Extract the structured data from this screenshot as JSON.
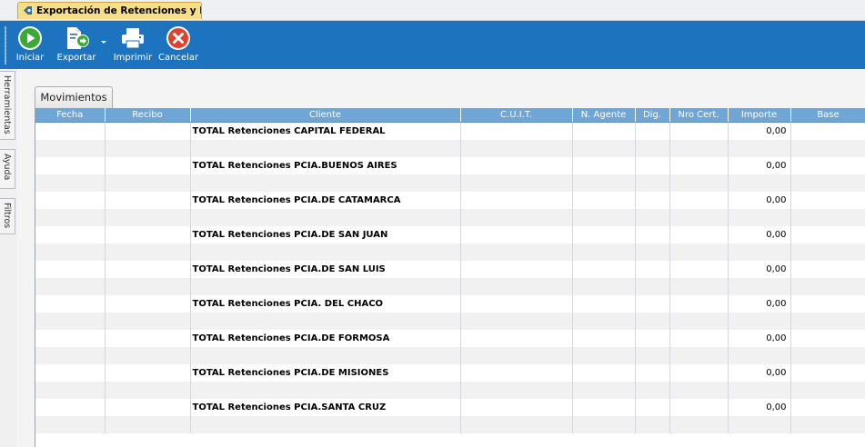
{
  "window": {
    "tab_title": "Exportación de Retenciones y Pe..."
  },
  "toolbar": {
    "iniciar": "Iniciar",
    "exportar": "Exportar",
    "imprimir": "Imprimir",
    "cancelar": "Cancelar"
  },
  "side_tabs": {
    "herramientas": "Herramientas",
    "ayuda": "Ayuda",
    "filtros": "Filtros"
  },
  "grid": {
    "tab_label": "Movimientos",
    "columns": [
      "Fecha",
      "Recibo",
      "Cliente",
      "C.U.I.T.",
      "N. Agente",
      "Dig.",
      "Nro Cert.",
      "Importe",
      "Base"
    ],
    "rows": [
      {
        "cliente": "TOTAL Retenciones CAPITAL FEDERAL",
        "importe": "0,00"
      },
      {
        "cliente": "",
        "importe": ""
      },
      {
        "cliente": "TOTAL Retenciones PCIA.BUENOS AIRES",
        "importe": "0,00"
      },
      {
        "cliente": "",
        "importe": ""
      },
      {
        "cliente": "TOTAL Retenciones PCIA.DE CATAMARCA",
        "importe": "0,00"
      },
      {
        "cliente": "",
        "importe": ""
      },
      {
        "cliente": "TOTAL Retenciones PCIA.DE SAN JUAN",
        "importe": "0,00"
      },
      {
        "cliente": "",
        "importe": ""
      },
      {
        "cliente": "TOTAL Retenciones PCIA.DE SAN LUIS",
        "importe": "0,00"
      },
      {
        "cliente": "",
        "importe": ""
      },
      {
        "cliente": "TOTAL Retenciones PCIA. DEL CHACO",
        "importe": "0,00"
      },
      {
        "cliente": "",
        "importe": ""
      },
      {
        "cliente": "TOTAL Retenciones PCIA.DE FORMOSA",
        "importe": "0,00"
      },
      {
        "cliente": "",
        "importe": ""
      },
      {
        "cliente": "TOTAL Retenciones PCIA.DE MISIONES",
        "importe": "0,00"
      },
      {
        "cliente": "",
        "importe": ""
      },
      {
        "cliente": "TOTAL Retenciones PCIA.SANTA CRUZ",
        "importe": "0,00"
      },
      {
        "cliente": "",
        "importe": ""
      }
    ]
  },
  "colors": {
    "toolbar_bg": "#1e73be",
    "header_bg": "#6fa6d6",
    "tab_active": "#f7df8a",
    "green_icon": "#3aa935",
    "red_icon": "#e0402f"
  }
}
